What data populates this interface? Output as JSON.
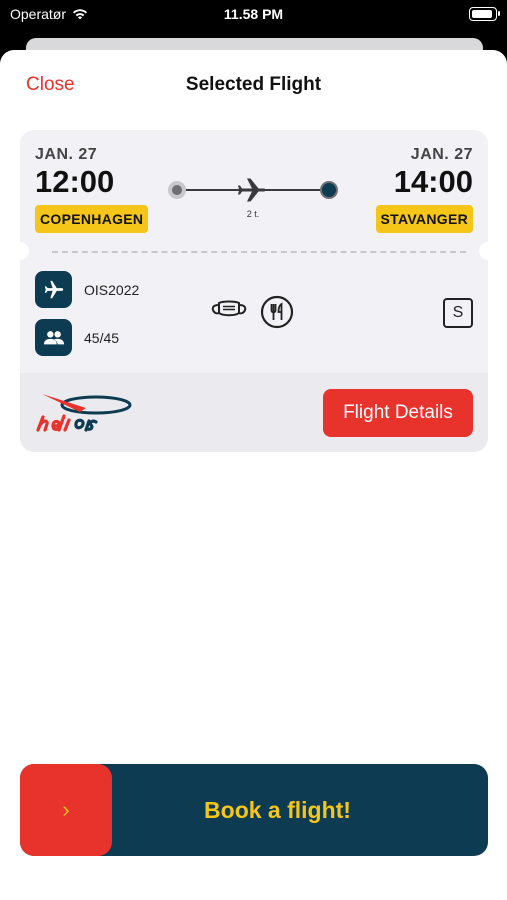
{
  "status_bar": {
    "carrier": "Operatør",
    "time": "11.58 PM"
  },
  "header": {
    "close_label": "Close",
    "title": "Selected Flight"
  },
  "flight": {
    "departure": {
      "date": "JAN. 27",
      "time": "12:00",
      "city": "COPENHAGEN"
    },
    "arrival": {
      "date": "JAN. 27",
      "time": "14:00",
      "city": "STAVANGER"
    },
    "duration": "2 t.",
    "flight_number": "OIS2022",
    "seats": "45/45",
    "seat_class": "S",
    "amenities": [
      "mask-icon",
      "restaurant-icon"
    ]
  },
  "footer": {
    "details_label": "Flight Details",
    "logo_text": "heliois"
  },
  "book": {
    "arrow": "›",
    "label": "Book a flight!"
  },
  "colors": {
    "accent_red": "#e8322c",
    "navy": "#0d3b52",
    "yellow": "#f5c518"
  }
}
